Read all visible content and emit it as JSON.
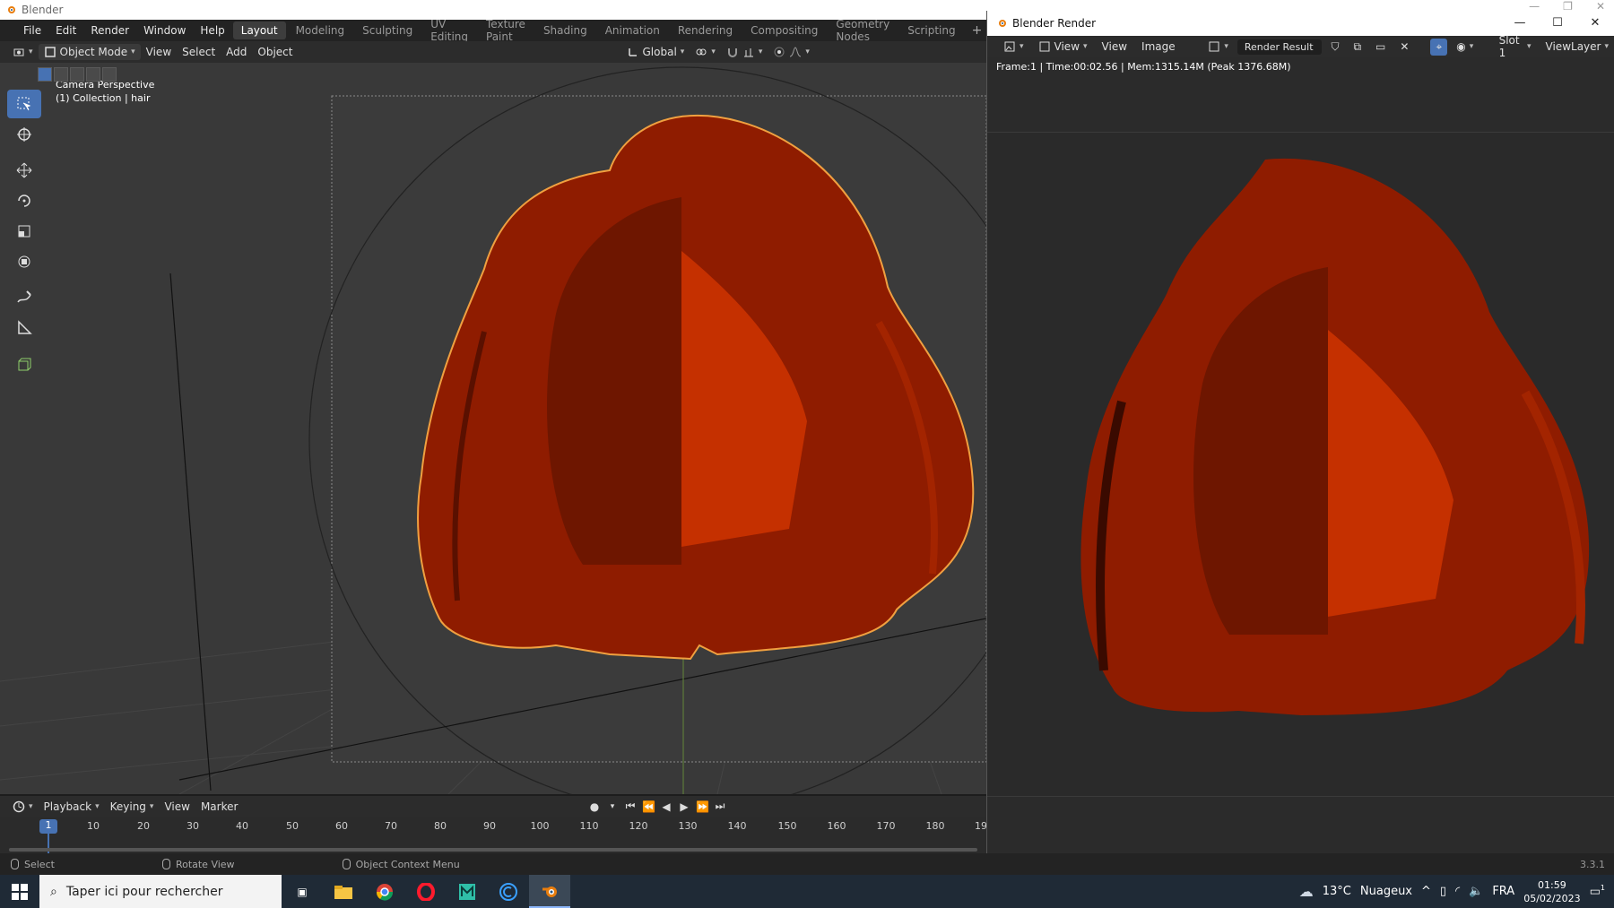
{
  "os": {
    "title": "Blender"
  },
  "menubar": {
    "items": [
      "File",
      "Edit",
      "Render",
      "Window",
      "Help"
    ],
    "workspaces": [
      "Layout",
      "Modeling",
      "Sculpting",
      "UV Editing",
      "Texture Paint",
      "Shading",
      "Animation",
      "Rendering",
      "Compositing",
      "Geometry Nodes",
      "Scripting"
    ],
    "active_workspace": "Layout",
    "add": "+"
  },
  "viewport_header": {
    "mode": "Object Mode",
    "menus": [
      "View",
      "Select",
      "Add",
      "Object"
    ],
    "transform_orientation": "Global"
  },
  "viewport": {
    "camera_label": "Camera Perspective",
    "collection_label": "(1) Collection | hair"
  },
  "timeline": {
    "menus": [
      "Playback",
      "Keying",
      "View",
      "Marker"
    ],
    "current_frame": "1",
    "ticks": [
      "10",
      "20",
      "30",
      "40",
      "50",
      "60",
      "70",
      "80",
      "90",
      "100",
      "110",
      "120",
      "130",
      "140",
      "150",
      "160",
      "170",
      "180",
      "19"
    ]
  },
  "statusbar": {
    "select": "Select",
    "rotate": "Rotate View",
    "context_menu": "Object Context Menu",
    "version": "3.3.1"
  },
  "render_window": {
    "title": "Blender Render",
    "menus": [
      "View",
      "View",
      "Image"
    ],
    "image_name": "Render Result",
    "slot": "Slot 1",
    "view_layer": "ViewLayer",
    "info": "Frame:1 | Time:00:02.56 | Mem:1315.14M (Peak 1376.68M)"
  },
  "taskbar": {
    "search_placeholder": "Taper ici pour rechercher",
    "weather_temp": "13°C",
    "weather_desc": "Nuageux",
    "language": "FRA",
    "time": "01:59",
    "date": "05/02/2023",
    "notification_count": "1"
  },
  "colors": {
    "accent": "#4772b3",
    "hair": "#b12400",
    "selection_outline": "#f0a040"
  }
}
